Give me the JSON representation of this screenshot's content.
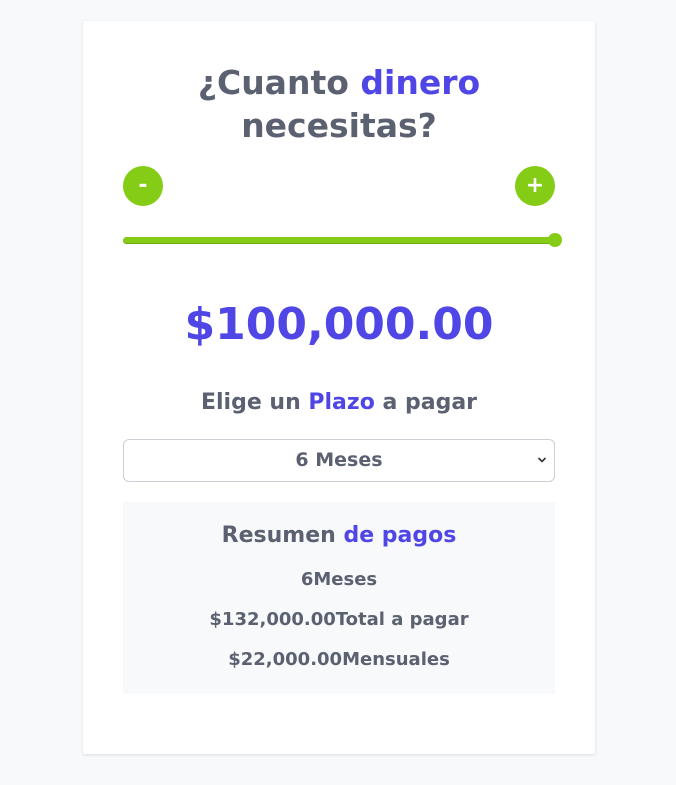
{
  "header": {
    "title_part1": "¿Cuanto ",
    "title_accent": "dinero",
    "title_part2": "necesitas?"
  },
  "controls": {
    "minus_label": "-",
    "plus_label": "+"
  },
  "slider": {
    "value_fraction": 1.0,
    "fill_color": "#84cc16"
  },
  "amount": {
    "display": "$100,000.00"
  },
  "term": {
    "label_part1": "Elige un ",
    "label_accent": "Plazo",
    "label_part2": " a pagar",
    "selected": "6 Meses"
  },
  "summary": {
    "title_part1": "Resumen ",
    "title_accent": "de pagos",
    "months_value": "6",
    "months_label": "Meses",
    "total_value": "$132,000.00",
    "total_label": "Total a pagar",
    "monthly_value": "$22,000.00",
    "monthly_label": "Mensuales"
  },
  "colors": {
    "accent": "#4f46e5",
    "green": "#84cc16",
    "text": "#5b6170"
  }
}
